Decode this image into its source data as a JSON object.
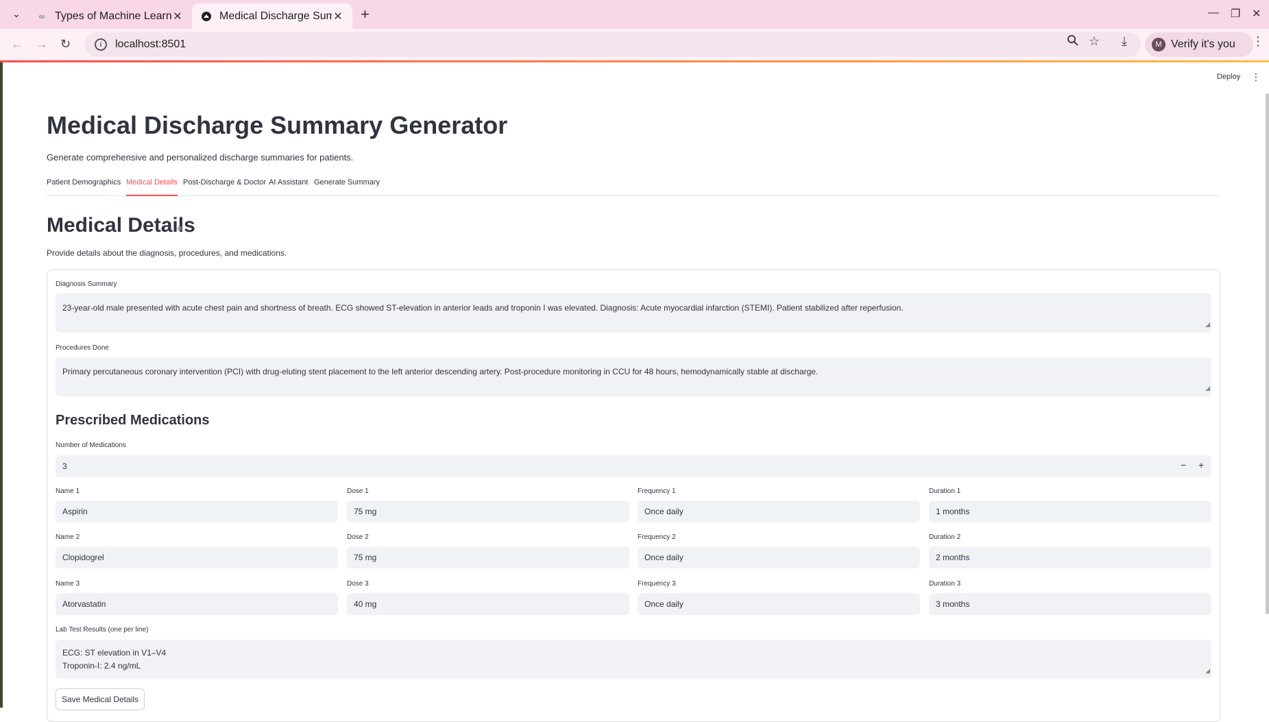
{
  "browser": {
    "tabs": [
      {
        "title": "Types of Machine Learni"
      },
      {
        "title": "Medical Discharge Summ"
      }
    ],
    "url": "localhost:8501",
    "verify_label": "Verify it's you",
    "avatar_letter": "M"
  },
  "app": {
    "deploy_label": "Deploy",
    "title": "Medical Discharge Summary Generator",
    "subtitle": "Generate comprehensive and personalized discharge summaries for patients.",
    "tabs": [
      "Patient Demographics",
      "Medical Details",
      "Post-Discharge & Doctor",
      "AI Assistant",
      "Generate Summary"
    ],
    "active_tab": "Medical Details",
    "section_title": "Medical Details",
    "section_desc": "Provide details about the diagnosis, procedures, and medications.",
    "diagnosis": {
      "label": "Diagnosis Summary",
      "value": "23-year-old male presented with acute chest pain and shortness of breath. ECG showed ST-elevation in anterior leads and troponin I was elevated. Diagnosis: Acute myocardial infarction (STEMI). Patient stabilized after reperfusion."
    },
    "procedures": {
      "label": "Procedures Done",
      "value": "Primary percutaneous coronary intervention (PCI) with drug-eluting stent placement to the left anterior descending artery. Post-procedure monitoring in CCU for 48 hours, hemodynamically stable at discharge."
    },
    "medications_title": "Prescribed Medications",
    "num_meds": {
      "label": "Number of Medications",
      "value": "3",
      "minus": "−",
      "plus": "+"
    },
    "medications": [
      {
        "name_label": "Name 1",
        "name": "Aspirin",
        "dose_label": "Dose 1",
        "dose": "75 mg",
        "freq_label": "Frequency 1",
        "freq": "Once daily",
        "dur_label": "Duration 1",
        "dur": "1 months"
      },
      {
        "name_label": "Name 2",
        "name": "Clopidogrel",
        "dose_label": "Dose 2",
        "dose": "75 mg",
        "freq_label": "Frequency 2",
        "freq": "Once daily",
        "dur_label": "Duration 2",
        "dur": "2 months"
      },
      {
        "name_label": "Name 3",
        "name": "Atorvastatin",
        "dose_label": "Dose 3",
        "dose": "40 mg",
        "freq_label": "Frequency 3",
        "freq": "Once daily",
        "dur_label": "Duration 3",
        "dur": "3 months"
      }
    ],
    "lab": {
      "label": "Lab Test Results (one per line)",
      "line1": "ECG: ST elevation in V1–V4",
      "line2": "Troponin-I: 2.4 ng/mL"
    },
    "save_label": "Save Medical Details"
  }
}
